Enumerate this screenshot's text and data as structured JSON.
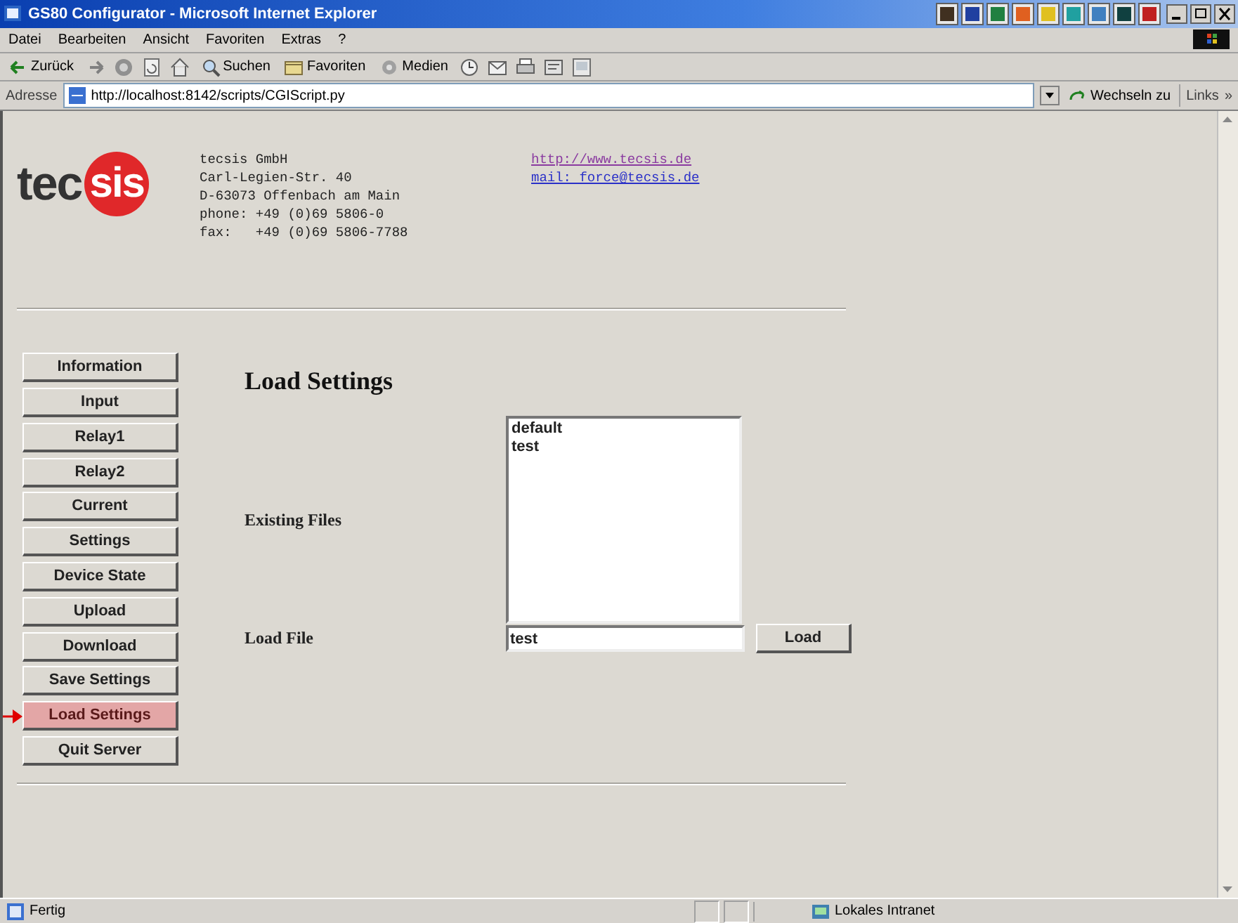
{
  "window": {
    "title": "GS80 Configurator - Microsoft Internet Explorer"
  },
  "menu": [
    "Datei",
    "Bearbeiten",
    "Ansicht",
    "Favoriten",
    "Extras",
    "?"
  ],
  "toolbar": [
    {
      "kind": "back",
      "label": "Zurück"
    },
    {
      "kind": "forward"
    },
    {
      "kind": "stop"
    },
    {
      "kind": "refresh"
    },
    {
      "kind": "home"
    },
    {
      "kind": "search",
      "label": "Suchen"
    },
    {
      "kind": "favorites",
      "label": "Favoriten"
    },
    {
      "kind": "media",
      "label": "Medien"
    },
    {
      "kind": "history"
    },
    {
      "kind": "mail"
    },
    {
      "kind": "print"
    },
    {
      "kind": "edit"
    },
    {
      "kind": "messenger"
    }
  ],
  "address_bar": {
    "label": "Adresse",
    "url": "http://localhost:8142/scripts/CGIScript.py",
    "go": "Wechseln zu",
    "links": "Links",
    "more": "»"
  },
  "logo": {
    "left": "tec",
    "right": "sis"
  },
  "company": [
    "tecsis GmbH",
    "Carl-Legien-Str. 40",
    "D-63073 Offenbach am Main",
    "phone: +49 (0)69 5806-0",
    "fax:   +49 (0)69 5806-7788"
  ],
  "links": [
    {
      "text": "http://www.tecsis.de",
      "visited": true
    },
    {
      "text": "mail: force@tecsis.de",
      "visited": false
    }
  ],
  "nav": [
    {
      "label": "Information",
      "selected": false
    },
    {
      "label": "Input",
      "selected": false
    },
    {
      "label": "Relay1",
      "selected": false
    },
    {
      "label": "Relay2",
      "selected": false
    },
    {
      "label": "Current",
      "selected": false
    },
    {
      "label": "Settings",
      "selected": false
    },
    {
      "label": "Device State",
      "selected": false
    },
    {
      "label": "Upload",
      "selected": false
    },
    {
      "label": "Download",
      "selected": false
    },
    {
      "label": "Save Settings",
      "selected": false
    },
    {
      "label": "Load Settings",
      "selected": true
    },
    {
      "label": "Quit Server",
      "selected": false
    }
  ],
  "form": {
    "heading": "Load Settings",
    "files_label": "Existing Files",
    "files": [
      "default",
      "test"
    ],
    "load_label": "Load File",
    "load_value": "test",
    "load_button": "Load"
  },
  "status_bar": {
    "text": "Fertig",
    "zone": "Lokales Intranet"
  }
}
